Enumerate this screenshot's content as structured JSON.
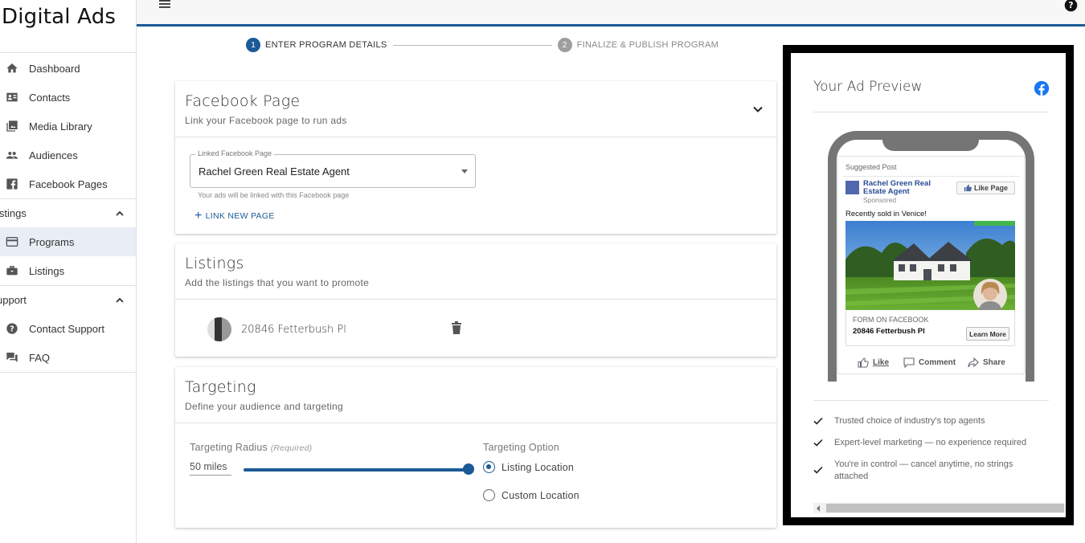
{
  "app": {
    "title": "Digital Ads"
  },
  "sidebar": {
    "items": [
      {
        "label": "Dashboard",
        "icon": "home-icon"
      },
      {
        "label": "Contacts",
        "icon": "contact-card-icon"
      },
      {
        "label": "Media Library",
        "icon": "photo-library-icon"
      },
      {
        "label": "Audiences",
        "icon": "people-icon"
      },
      {
        "label": "Facebook Pages",
        "icon": "facebook-icon"
      }
    ],
    "listings_section": {
      "label": "istings",
      "items": [
        {
          "label": "Programs",
          "icon": "credit-card-icon",
          "active": true
        },
        {
          "label": "Listings",
          "icon": "briefcase-icon"
        }
      ]
    },
    "support_section": {
      "label": "upport",
      "items": [
        {
          "label": "Contact Support",
          "icon": "help-circle-icon"
        },
        {
          "label": "FAQ",
          "icon": "forum-icon"
        }
      ]
    }
  },
  "stepper": {
    "steps": [
      {
        "num": "1",
        "label": "ENTER PROGRAM DETAILS",
        "active": true
      },
      {
        "num": "2",
        "label": "FINALIZE & PUBLISH PROGRAM",
        "active": false
      }
    ]
  },
  "facebook_page": {
    "title": "Facebook Page",
    "subtitle": "Link your Facebook page to run ads",
    "field_label": "Linked Facebook Page",
    "field_value": "Rachel Green Real Estate Agent",
    "helper": "Your ads will be linked with this Facebook page",
    "link_new": "LINK NEW PAGE"
  },
  "listings": {
    "title": "Listings",
    "subtitle": "Add the listings that you want to promote",
    "rows": [
      {
        "address": "20846 Fetterbush Pl"
      }
    ]
  },
  "targeting": {
    "title": "Targeting",
    "subtitle": "Define your audience and targeting",
    "radius_label": "Targeting Radius",
    "radius_required": "(Required)",
    "radius_value": "50",
    "radius_unit": "miles",
    "radius_slider_fraction": 1.0,
    "option_label": "Targeting Option",
    "options": [
      {
        "label": "Listing Location",
        "selected": true
      },
      {
        "label": "Custom Location",
        "selected": false
      }
    ]
  },
  "preview": {
    "title": "Your Ad Preview",
    "suggested": "Suggested Post",
    "page_name": "Rachel Green Real Estate Agent",
    "sponsored": "Sponsored",
    "like_page": "Like Page",
    "post_text": "Recently sold in Venice!",
    "form_label": "FORM ON FACEBOOK",
    "address": "20846 Fetterbush Pl",
    "cta": "Learn More",
    "actions": {
      "like": "Like",
      "comment": "Comment",
      "share": "Share"
    },
    "perks": [
      "Trusted choice of industry's top agents",
      "Expert-level marketing — no experience required",
      "You're in control — cancel anytime, no strings attached"
    ]
  },
  "colors": {
    "primary": "#1a5a96",
    "facebook": "#1877f2",
    "fb_link": "#2b4c94"
  }
}
